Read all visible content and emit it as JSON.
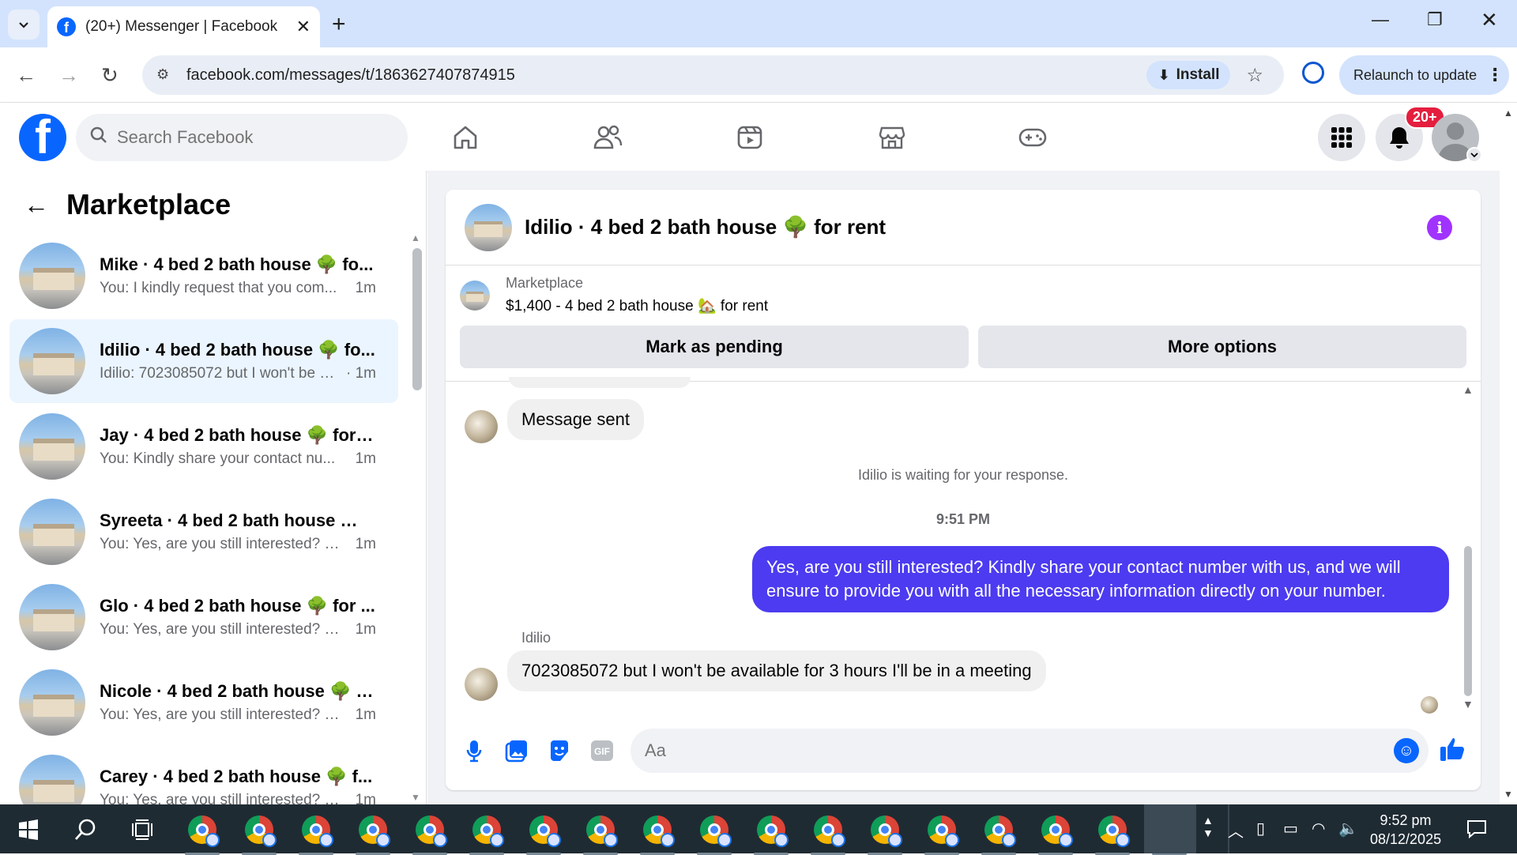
{
  "browser": {
    "tab_title": "(20+) Messenger | Facebook",
    "url": "facebook.com/messages/t/1863627407874915",
    "install_label": "Install",
    "relaunch_label": "Relaunch to update"
  },
  "fb_nav": {
    "search_placeholder": "Search Facebook",
    "notification_badge": "20+"
  },
  "sidebar": {
    "title": "Marketplace",
    "conversations": [
      {
        "name": "Mike · 4 bed 2 bath house 🌳 fo...",
        "snippet": "You: I kindly request that you com...",
        "time": "1m"
      },
      {
        "name": "Idilio · 4 bed 2 bath house 🌳 fo...",
        "snippet": "Idilio: 7023085072 but I won't be a...",
        "time": "· 1m"
      },
      {
        "name": "Jay · 4 bed 2 bath house 🌳 for r...",
        "snippet": "You: Kindly share your contact nu...",
        "time": "1m"
      },
      {
        "name": "Syreeta · 4 bed 2 bath house 🌳 ...",
        "snippet": "You: Yes, are you still interested? Ki...",
        "time": "1m"
      },
      {
        "name": "Glo · 4 bed 2 bath house 🌳 for ...",
        "snippet": "You: Yes, are you still interested? Ki...",
        "time": "1m"
      },
      {
        "name": "Nicole · 4 bed 2 bath house 🌳 f...",
        "snippet": "You: Yes, are you still interested? Ki...",
        "time": "1m"
      },
      {
        "name": "Carey · 4 bed 2 bath house 🌳 f...",
        "snippet": "You: Yes, are you still interested? Ki...",
        "time": "1m"
      }
    ]
  },
  "chat": {
    "title": "Idilio · 4 bed 2 bath house 🌳 for rent",
    "listing_category": "Marketplace",
    "listing_price": "$1,400 - 4 bed 2 bath house 🏡 for rent",
    "mark_pending_label": "Mark as pending",
    "more_options_label": "More options",
    "messages": {
      "message_sent": "Message sent",
      "waiting": "Idilio is waiting for your response.",
      "timestamp": "9:51 PM",
      "outgoing": "Yes, are you still interested? Kindly share your contact number with us, and we will ensure to provide you with all the necessary information directly on your number.",
      "sender_name": "Idilio",
      "incoming": "7023085072 but I won't be available for 3 hours I'll be in a meeting"
    },
    "composer_placeholder": "Aa"
  },
  "taskbar": {
    "time": "9:52 pm",
    "date": "08/12/2025"
  },
  "colors": {
    "fb_blue": "#0866ff",
    "outgoing_bubble": "#4c3bf0",
    "badge_red": "#e41e3f",
    "active_conv": "#ebf5ff"
  }
}
